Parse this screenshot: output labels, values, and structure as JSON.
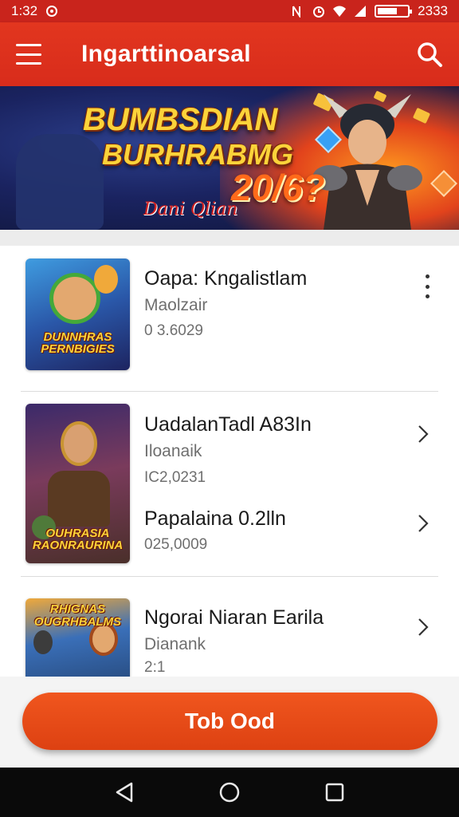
{
  "status_bar": {
    "time": "1:32",
    "right_text": "2333"
  },
  "app_bar": {
    "title": "Ingarttinoarsal"
  },
  "banner": {
    "line1": "BUMBSDIAN",
    "line2": "BURHRABMG",
    "year": "20/6?",
    "subtitle": "Dani Qlian"
  },
  "list": {
    "items": [
      {
        "title": "Oapa: Kngalistlam",
        "subtitle": "Maolzair",
        "number": "0 3.6029",
        "thumb_label": "DUNNHRAS PERNBIGIES",
        "action": "more"
      },
      {
        "title": "UadalanTadl A83In",
        "subtitle": "Iloanaik",
        "number": "IC2,0231",
        "thumb_label": "OUHRASIA RAONRAURINA",
        "action": "chevron"
      },
      {
        "title": "Papalaina 0.2lln",
        "subtitle": "",
        "number": "025,0009",
        "thumb_label": "",
        "action": "chevron"
      },
      {
        "title": "Ngorai Niaran Earila",
        "subtitle": "Dianank",
        "number": "2:1",
        "thumb_label": "RHIGNAS OUGRHBALMS",
        "action": "chevron"
      }
    ]
  },
  "cta": {
    "label": "Tob Ood"
  },
  "colors": {
    "primary": "#d82c1b",
    "cta": "#e84a16",
    "banner_gold": "#fbd33a"
  }
}
